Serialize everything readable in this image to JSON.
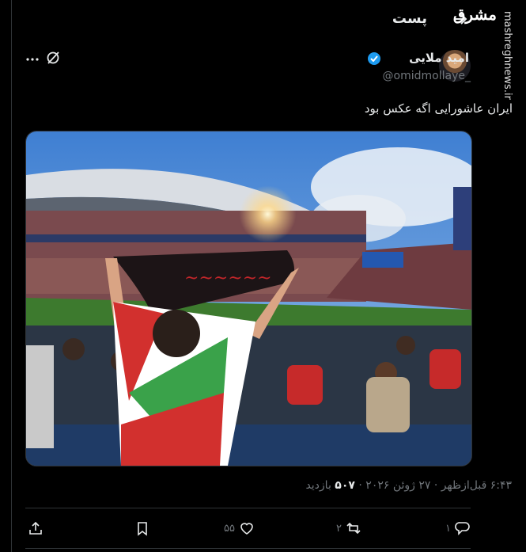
{
  "header": {
    "title": "پست",
    "watermark_logo": "مشرق",
    "side_watermark": "mashreghnews.ir"
  },
  "author": {
    "name": "امید ملایی",
    "handle": "@omidmollaye_"
  },
  "tweet": {
    "text": "ایران عاشورایی اگه عکس بود",
    "photo_alt": "Fan in stadium holding flag"
  },
  "meta": {
    "time": "۶:۴۳ قبل‌ازظهر",
    "sep": "·",
    "date": "۲۷ ژوئن ۲۰۲۶",
    "views_count": "۵۰۷",
    "views_label": "بازدید"
  },
  "actions": {
    "reply_count": "۱",
    "retweet_count": "۲",
    "like_count": "۵۵"
  },
  "icons": [
    "back-arrow-icon",
    "more-icon",
    "grok-icon",
    "verified-icon",
    "reply-icon",
    "retweet-icon",
    "like-icon",
    "bookmark-icon",
    "share-icon"
  ]
}
